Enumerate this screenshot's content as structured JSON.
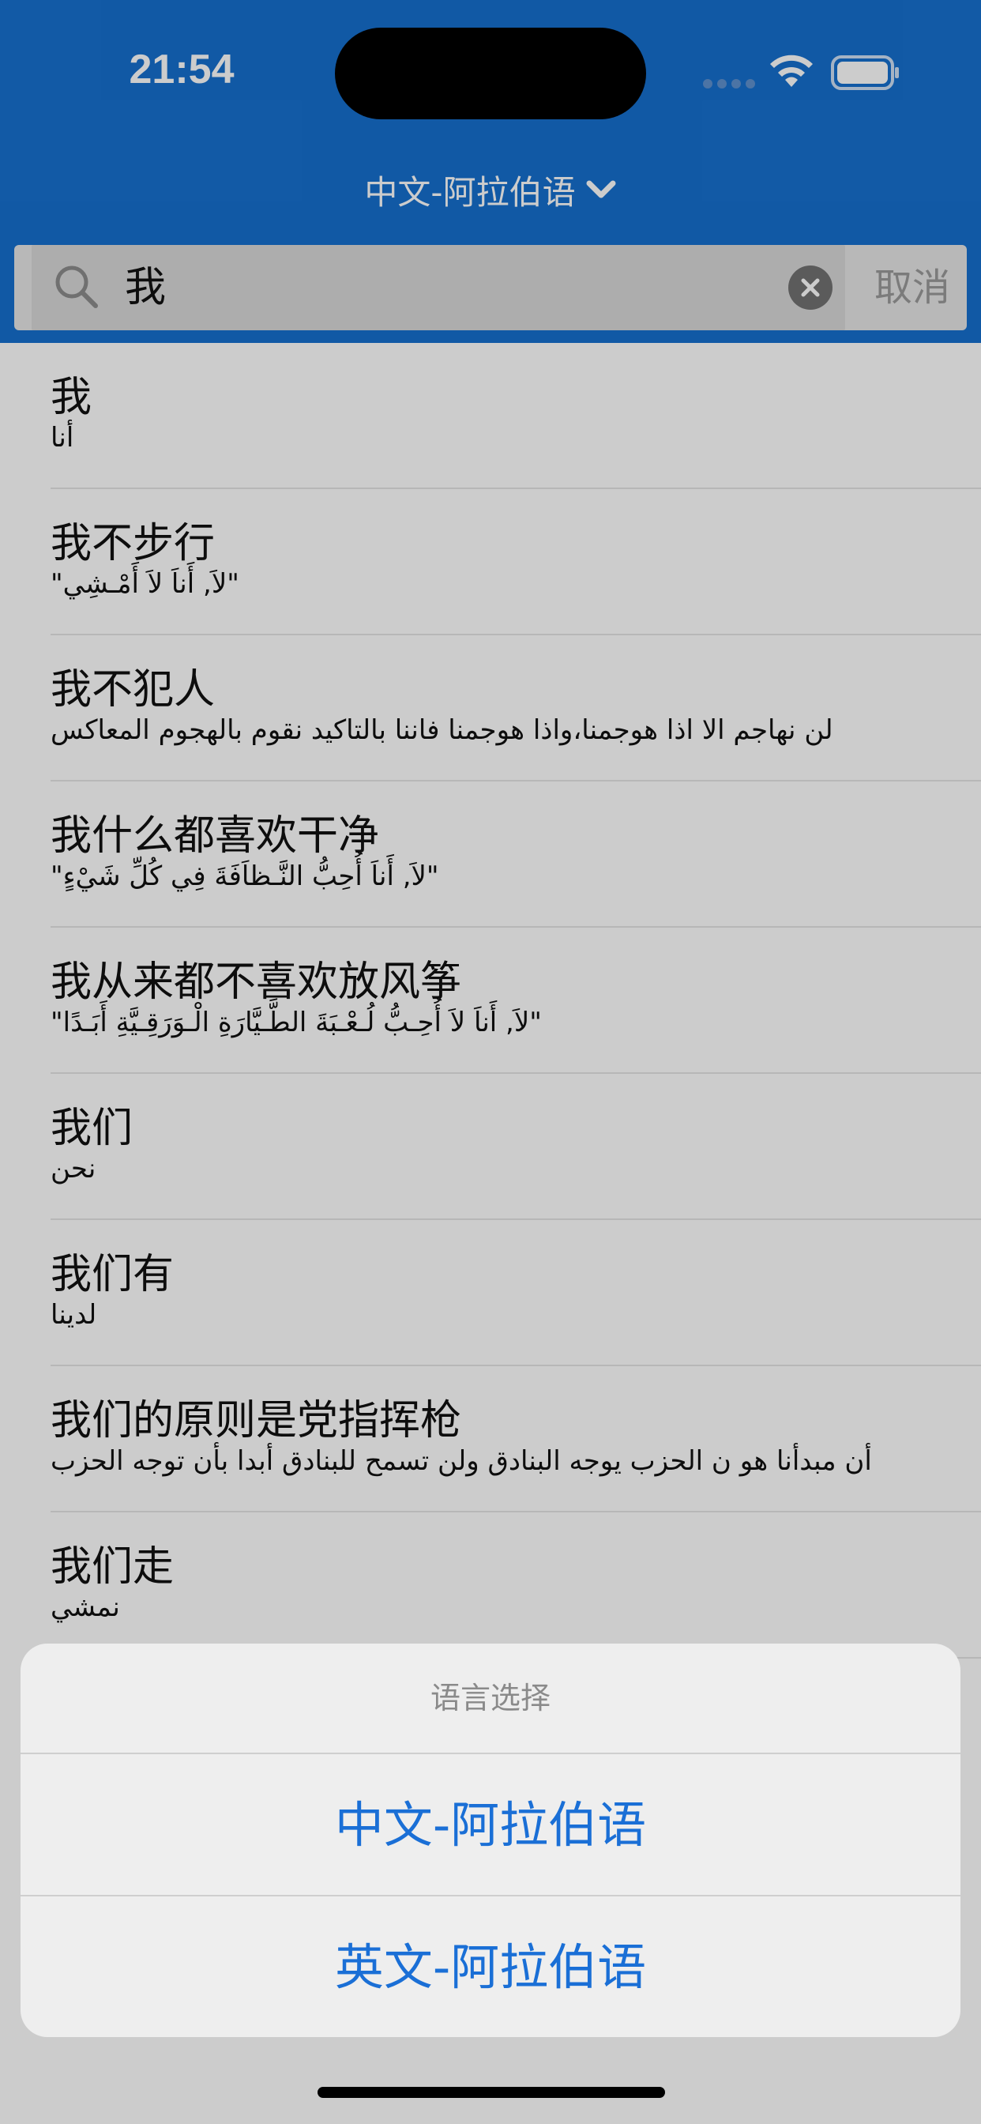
{
  "status_bar": {
    "time": "21:54"
  },
  "header": {
    "title": "中文-阿拉伯语"
  },
  "search": {
    "value": "我",
    "cancel_label": "取消"
  },
  "results": [
    {
      "zh": "我",
      "ar": "أنا"
    },
    {
      "zh": "我不步行",
      "ar": "\"لاَ, أَناَ لاَ أَمْـشِي\""
    },
    {
      "zh": "我不犯人",
      "ar": "لن نهاجم الا اذا هوجمنا،واذا هوجمنا فاننا بالتاكيد نقوم بالهجوم المعاكس"
    },
    {
      "zh": "我什么都喜欢干净",
      "ar": "\"لاَ, أَناَ أُحِبُّ النَّـظاَفَةَ فِي كُلِّ شَيْءٍ\""
    },
    {
      "zh": "我从来都不喜欢放风筝",
      "ar": "\"لاَ, أَناَ لاَ أُحِـبُّ لُـعْـبَةَ الطَّـيَّارَةِ الْـوَرَقِـيَّةِ أَبَـدًا\""
    },
    {
      "zh": "我们",
      "ar": "نحن"
    },
    {
      "zh": "我们有",
      "ar": "لدينا"
    },
    {
      "zh": "我们的原则是党指挥枪",
      "ar": "أن مبدأنا هو ن الحزب يوجه البنادق ولن تسمح للبنادق أبدا بأن توجه الحزب"
    },
    {
      "zh": "我们走",
      "ar": "نمشي"
    }
  ],
  "action_sheet": {
    "title": "语言选择",
    "options": [
      "中文-阿拉伯语",
      "英文-阿拉伯语"
    ]
  },
  "colors": {
    "header": "#1670cf",
    "option_text": "#1a6fd6"
  },
  "icons": [
    "search-icon",
    "clear-icon",
    "chevron-down-icon",
    "wifi-icon",
    "battery-icon"
  ]
}
